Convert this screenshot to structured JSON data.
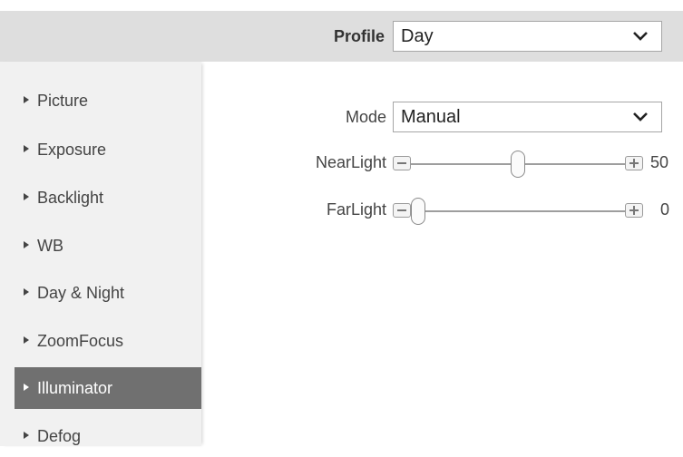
{
  "header": {
    "profile_label": "Profile",
    "profile_value": "Day"
  },
  "sidebar": {
    "items": [
      {
        "label": "Picture",
        "active": false
      },
      {
        "label": "Exposure",
        "active": false
      },
      {
        "label": "Backlight",
        "active": false
      },
      {
        "label": "WB",
        "active": false
      },
      {
        "label": "Day & Night",
        "active": false
      },
      {
        "label": "ZoomFocus",
        "active": false
      },
      {
        "label": "Illuminator",
        "active": true
      },
      {
        "label": "Defog",
        "active": false
      }
    ]
  },
  "main": {
    "mode_label": "Mode",
    "mode_value": "Manual",
    "near_light": {
      "label": "NearLight",
      "value": "50",
      "level": 0.5
    },
    "far_light": {
      "label": "FarLight",
      "value": "0",
      "level": 0
    }
  },
  "colors": {
    "header_bg": "#dedede",
    "sidebar_bg": "#f1f1f1",
    "active_item_bg": "#707070"
  },
  "icons": [
    "chevron-down-icon",
    "triangle-right-icon",
    "minus-icon",
    "plus-icon"
  ]
}
